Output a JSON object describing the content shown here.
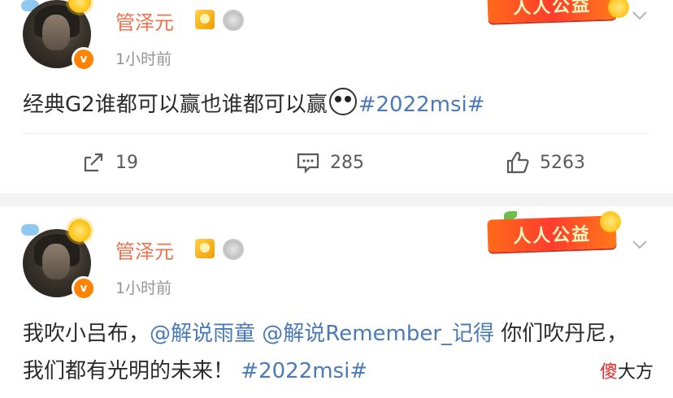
{
  "posts": [
    {
      "username": "管泽元",
      "timestamp": "1小时前",
      "charity_badge": "人人公益",
      "text_plain": "经典G2谁都可以赢也谁都可以赢",
      "hashtag": "#2022msi#",
      "actions": {
        "repost_count": "19",
        "comment_count": "285",
        "like_count": "5263"
      }
    },
    {
      "username": "管泽元",
      "timestamp": "1小时前",
      "charity_badge": "人人公益",
      "text_part1": "我吹小吕布，",
      "mention1": "@解说雨童",
      "mention2": "@解说Remember_记得",
      "text_part2": " 你们吹丹尼，我们都有光明的未来！",
      "hashtag": "#2022msi#"
    }
  ],
  "watermark": {
    "part1": "傻",
    "part2": "大方"
  },
  "colors": {
    "username": "#eb7350",
    "link": "#4a7ab8",
    "timestamp": "#939393",
    "verify": "#ff8200"
  },
  "icons": [
    "repost-icon",
    "comment-icon",
    "like-icon",
    "chevron-down-icon",
    "verified-icon",
    "vip-icon",
    "medal-icon"
  ]
}
